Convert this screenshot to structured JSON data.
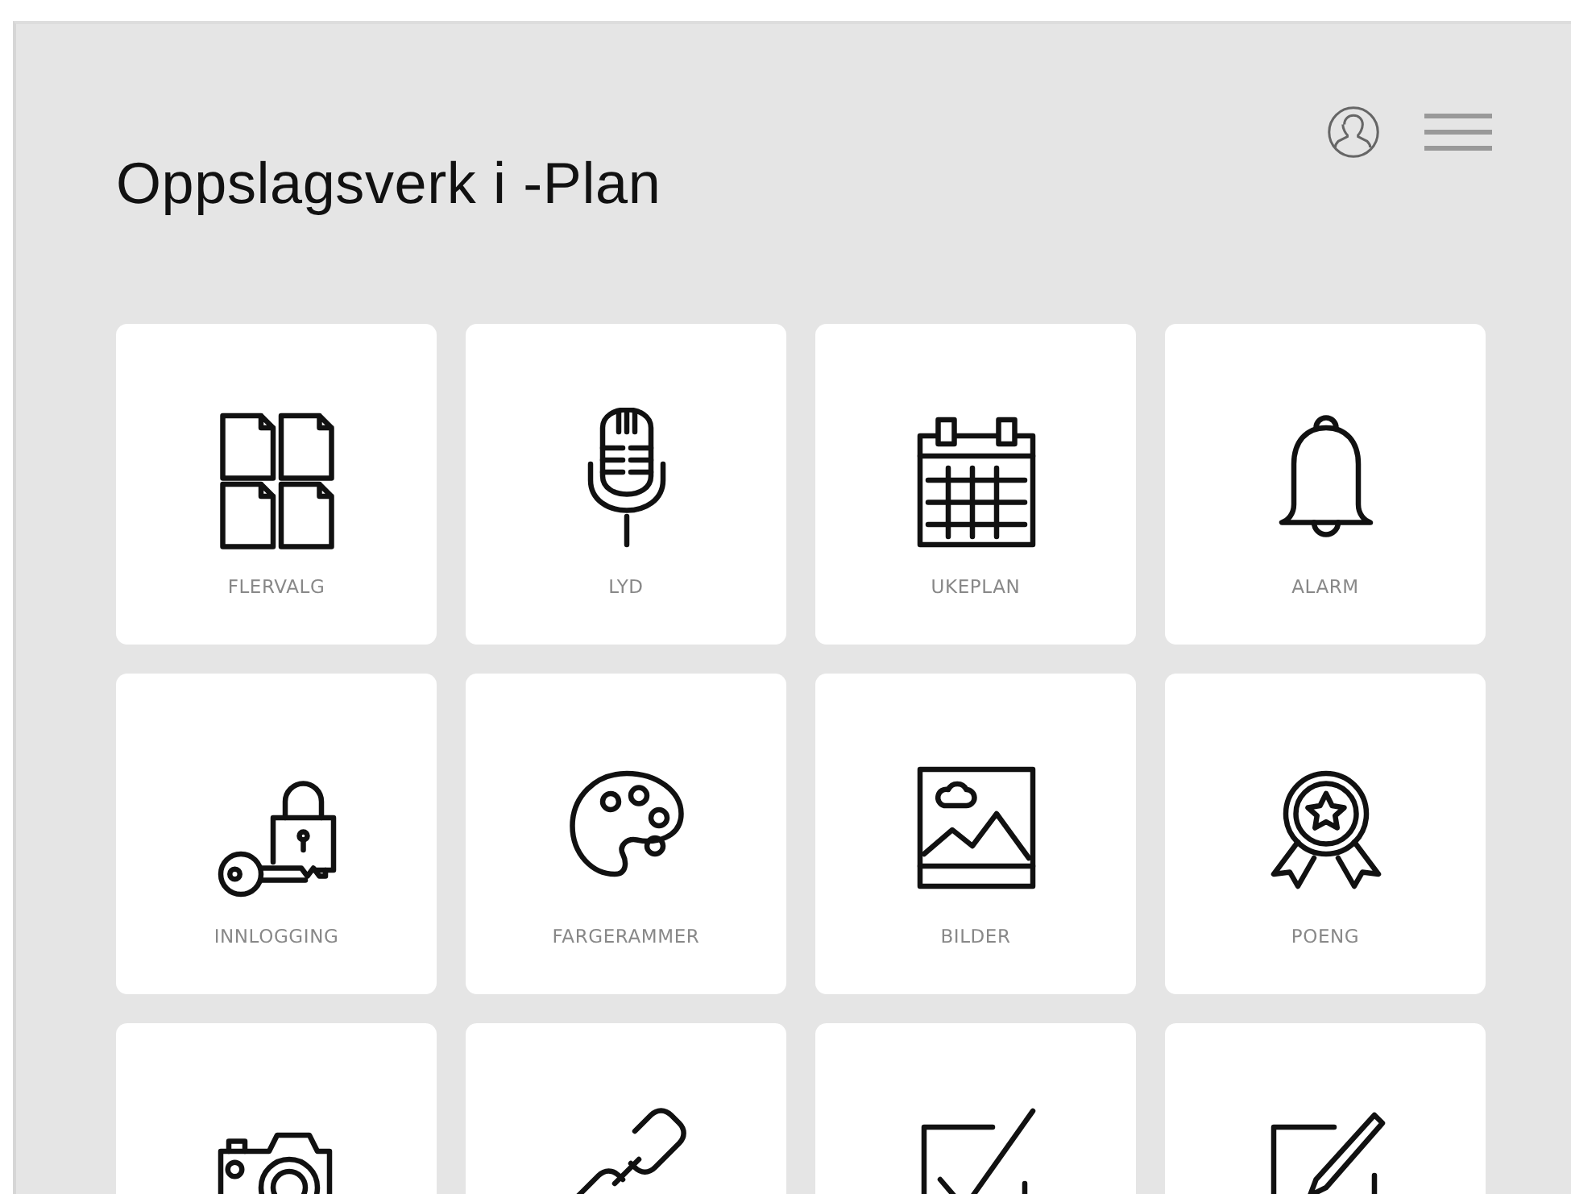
{
  "header": {
    "title": "Oppslagsverk i -Plan"
  },
  "toolbar": [
    {
      "kind": "user"
    },
    {
      "kind": "menu"
    }
  ],
  "tiles": [
    {
      "kind": "files",
      "label": "FLERVALG"
    },
    {
      "kind": "mic",
      "label": "LYD"
    },
    {
      "kind": "calendar",
      "label": "UKEPLAN"
    },
    {
      "kind": "bell",
      "label": "ALARM"
    },
    {
      "kind": "keylock",
      "label": "INNLOGGING"
    },
    {
      "kind": "palette",
      "label": "FARGERAMMER"
    },
    {
      "kind": "image",
      "label": "BILDER"
    },
    {
      "kind": "award",
      "label": "POENG"
    },
    {
      "kind": "camera"
    },
    {
      "kind": "link"
    },
    {
      "kind": "checkbox"
    },
    {
      "kind": "edit"
    }
  ]
}
